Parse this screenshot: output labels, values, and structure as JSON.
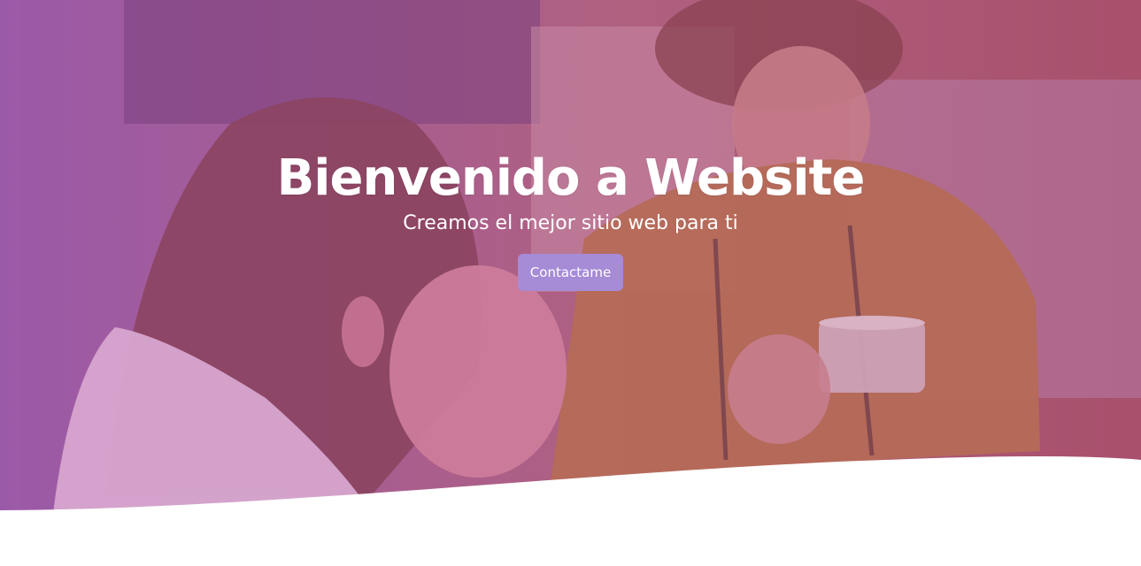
{
  "hero": {
    "title": "Bienvenido a Website",
    "subtitle": "Creamos el mejor sitio web para ti",
    "button_label": "Contactame"
  },
  "colors": {
    "overlay_left": "#9a5ca8",
    "overlay_right": "#b35a7a",
    "button": "#a68bd6",
    "wave": "#ffffff",
    "text": "#ffffff"
  }
}
